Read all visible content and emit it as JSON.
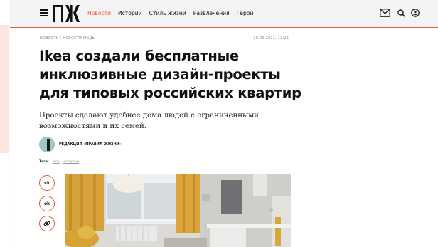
{
  "nav": {
    "items": [
      "Новости",
      "Истории",
      "Стиль жизни",
      "Развлечения",
      "Герои"
    ],
    "active_index": 0
  },
  "header_icons": [
    "mail-icon",
    "search-icon",
    "account-icon"
  ],
  "article": {
    "categories": "НОВОСТИ / НОВОСТИ МОДЫ",
    "date": "20.05.2021, 12:23",
    "title_lines": [
      "Ikea создали бесплатные",
      "инклюзивные дизайн-проекты",
      "для типовых российских квартир"
    ],
    "lead": "Проекты сделают удобнее дома людей с ограниченными возможностями и их семей.",
    "author": "РЕДАКЦИЯ «ПРАВИЛ ЖИЗНИ»",
    "tags_label": "Теги:",
    "tags": [
      "Ikea",
      "интерьер"
    ]
  },
  "share": {
    "vk": "vk",
    "ok": "ok"
  },
  "colors": {
    "accent": "#e45b3c",
    "header_bg": "#f4f4f4",
    "left_strip": "#fbe7df"
  }
}
